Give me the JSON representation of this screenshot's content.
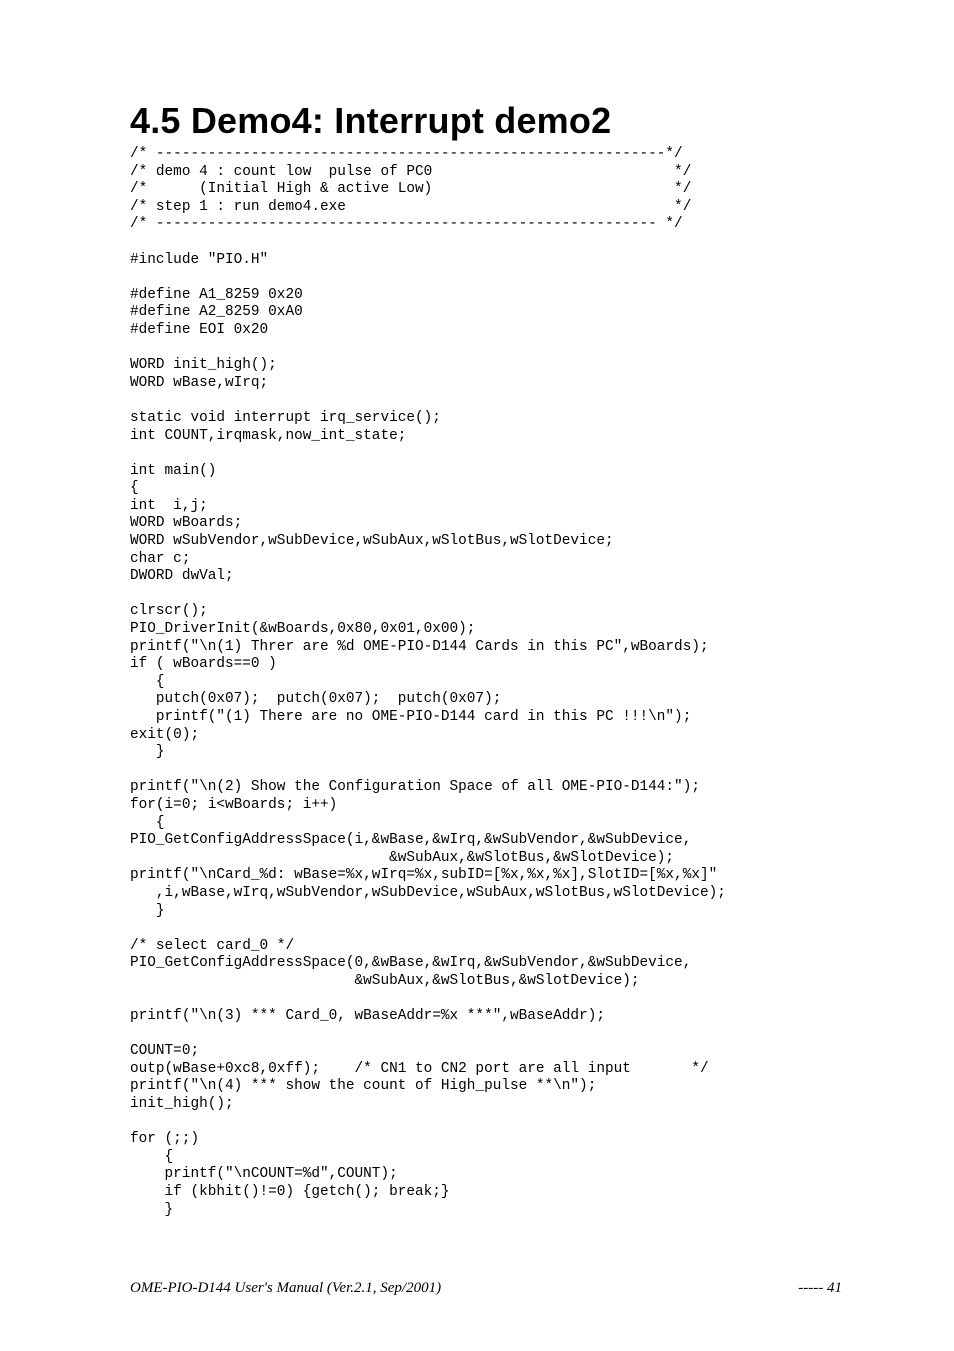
{
  "heading": "4.5   Demo4: Interrupt demo2",
  "code": "/* -----------------------------------------------------------*/\n/* demo 4 : count low  pulse of PC0                            */\n/*      (Initial High & active Low)                            */\n/* step 1 : run demo4.exe                                      */\n/* ---------------------------------------------------------- */\n\n#include \"PIO.H\"\n\n#define A1_8259 0x20\n#define A2_8259 0xA0\n#define EOI 0x20\n\nWORD init_high();\nWORD wBase,wIrq;\n\nstatic void interrupt irq_service();\nint COUNT,irqmask,now_int_state;\n\nint main()\n{\nint  i,j;\nWORD wBoards;\nWORD wSubVendor,wSubDevice,wSubAux,wSlotBus,wSlotDevice;\nchar c;\nDWORD dwVal;\n\nclrscr();\nPIO_DriverInit(&wBoards,0x80,0x01,0x00);\nprintf(\"\\n(1) Threr are %d OME-PIO-D144 Cards in this PC\",wBoards);\nif ( wBoards==0 )\n   {\n   putch(0x07);  putch(0x07);  putch(0x07);\n   printf(\"(1) There are no OME-PIO-D144 card in this PC !!!\\n\");\nexit(0);\n   }\n\nprintf(\"\\n(2) Show the Configuration Space of all OME-PIO-D144:\");\nfor(i=0; i<wBoards; i++)\n   {\nPIO_GetConfigAddressSpace(i,&wBase,&wIrq,&wSubVendor,&wSubDevice,\n                              &wSubAux,&wSlotBus,&wSlotDevice);\nprintf(\"\\nCard_%d: wBase=%x,wIrq=%x,subID=[%x,%x,%x],SlotID=[%x,%x]\"\n   ,i,wBase,wIrq,wSubVendor,wSubDevice,wSubAux,wSlotBus,wSlotDevice);\n   }\n\n/* select card_0 */\nPIO_GetConfigAddressSpace(0,&wBase,&wIrq,&wSubVendor,&wSubDevice,\n                          &wSubAux,&wSlotBus,&wSlotDevice);\n\nprintf(\"\\n(3) *** Card_0, wBaseAddr=%x ***\",wBaseAddr);\n\nCOUNT=0;\noutp(wBase+0xc8,0xff);    /* CN1 to CN2 port are all input       */\nprintf(\"\\n(4) *** show the count of High_pulse **\\n\");\ninit_high();\n\nfor (;;)\n    {\n    printf(\"\\nCOUNT=%d\",COUNT);\n    if (kbhit()!=0) {getch(); break;}\n    }",
  "footer_left": "OME-PIO-D144 User's Manual  (Ver.2.1, Sep/2001)",
  "footer_right": "-----  41"
}
